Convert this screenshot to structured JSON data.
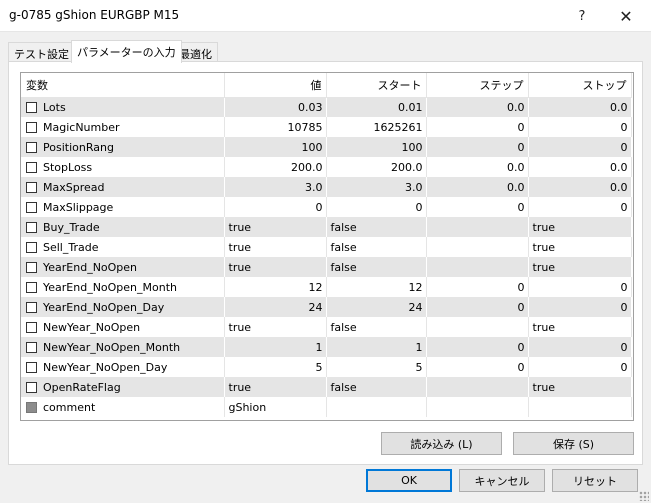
{
  "window": {
    "title": "g-0785 gShion EURGBP M15",
    "help": "?",
    "close": "✕"
  },
  "tabs": [
    {
      "label": "テスト設定",
      "active": false
    },
    {
      "label": "パラメーターの入力",
      "active": true
    },
    {
      "label": "最適化",
      "active": false
    }
  ],
  "columns": {
    "name": "変数",
    "value": "値",
    "start": "スタート",
    "step": "ステップ",
    "stop": "ストップ"
  },
  "rows": [
    {
      "name": "Lots",
      "value": "0.03",
      "start": "0.01",
      "step": "0.0",
      "stop": "0.0",
      "kind": "num",
      "checked": false
    },
    {
      "name": "MagicNumber",
      "value": "10785",
      "start": "1625261",
      "step": "0",
      "stop": "0",
      "kind": "num",
      "checked": false
    },
    {
      "name": "PositionRang",
      "value": "100",
      "start": "100",
      "step": "0",
      "stop": "0",
      "kind": "num",
      "checked": false
    },
    {
      "name": "StopLoss",
      "value": "200.0",
      "start": "200.0",
      "step": "0.0",
      "stop": "0.0",
      "kind": "num",
      "checked": false
    },
    {
      "name": "MaxSpread",
      "value": "3.0",
      "start": "3.0",
      "step": "0.0",
      "stop": "0.0",
      "kind": "num",
      "checked": false
    },
    {
      "name": "MaxSlippage",
      "value": "0",
      "start": "0",
      "step": "0",
      "stop": "0",
      "kind": "num",
      "checked": false
    },
    {
      "name": "Buy_Trade",
      "value": "true",
      "start": "false",
      "step": "",
      "stop": "true",
      "kind": "bool",
      "checked": false
    },
    {
      "name": "Sell_Trade",
      "value": "true",
      "start": "false",
      "step": "",
      "stop": "true",
      "kind": "bool",
      "checked": false
    },
    {
      "name": "YearEnd_NoOpen",
      "value": "true",
      "start": "false",
      "step": "",
      "stop": "true",
      "kind": "bool",
      "checked": false
    },
    {
      "name": "YearEnd_NoOpen_Month",
      "value": "12",
      "start": "12",
      "step": "0",
      "stop": "0",
      "kind": "num",
      "checked": false
    },
    {
      "name": "YearEnd_NoOpen_Day",
      "value": "24",
      "start": "24",
      "step": "0",
      "stop": "0",
      "kind": "num",
      "checked": false
    },
    {
      "name": "NewYear_NoOpen",
      "value": "true",
      "start": "false",
      "step": "",
      "stop": "true",
      "kind": "bool",
      "checked": false
    },
    {
      "name": "NewYear_NoOpen_Month",
      "value": "1",
      "start": "1",
      "step": "0",
      "stop": "0",
      "kind": "num",
      "checked": false
    },
    {
      "name": "NewYear_NoOpen_Day",
      "value": "5",
      "start": "5",
      "step": "0",
      "stop": "0",
      "kind": "num",
      "checked": false
    },
    {
      "name": "OpenRateFlag",
      "value": "true",
      "start": "false",
      "step": "",
      "stop": "true",
      "kind": "bool",
      "checked": false
    },
    {
      "name": "comment",
      "value": "gShion",
      "start": "",
      "step": "",
      "stop": "",
      "kind": "str",
      "checked": false,
      "disabled": true
    }
  ],
  "buttons": {
    "load": "読み込み (L)",
    "save": "保存 (S)",
    "ok": "OK",
    "cancel": "キャンセル",
    "reset": "リセット"
  }
}
